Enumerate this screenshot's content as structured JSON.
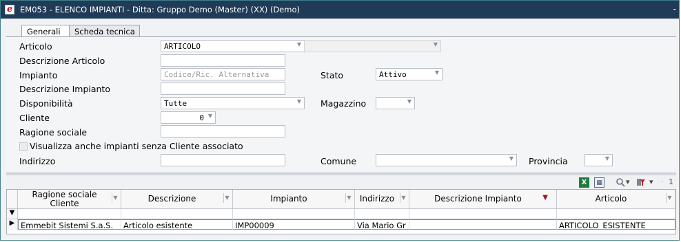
{
  "window": {
    "title": "EM053 - ELENCO IMPIANTI - Ditta: Gruppo Demo (Master) (XX)  (Demo)",
    "app_icon": "e-logo-icon",
    "control": "-"
  },
  "tabs": [
    {
      "label": "Generali",
      "active": true
    },
    {
      "label": "Scheda tecnica",
      "active": false
    }
  ],
  "form": {
    "articolo": {
      "label": "Articolo",
      "value": "ARTICOLO"
    },
    "descrizione_articolo": {
      "label": "Descrizione Articolo",
      "value": ""
    },
    "impianto": {
      "label": "Impianto",
      "placeholder": "Codice/Ric. Alternativa"
    },
    "stato": {
      "label": "Stato",
      "value": "Attivo"
    },
    "descrizione_impianto": {
      "label": "Descrizione Impianto",
      "value": ""
    },
    "disponibilita": {
      "label": "Disponibilità",
      "value": "Tutte"
    },
    "magazzino": {
      "label": "Magazzino",
      "value": ""
    },
    "cliente": {
      "label": "Cliente",
      "value": "0"
    },
    "ragione_sociale": {
      "label": "Ragione sociale",
      "value": ""
    },
    "checkbox_senza_cliente": {
      "label": "Visualizza anche impianti senza Cliente associato",
      "checked": false
    },
    "indirizzo": {
      "label": "Indirizzo",
      "value": ""
    },
    "comune": {
      "label": "Comune",
      "value": ""
    },
    "provincia": {
      "label": "Provincia",
      "value": ""
    }
  },
  "toolbar": {
    "excel_icon": "excel-export-icon",
    "layout_icon": "grid-layout-icon",
    "search_icon": "search-icon",
    "filter_icon": "filter-icon",
    "dropdown_glyph": "▾",
    "trailing": "1"
  },
  "grid": {
    "columns": [
      {
        "label": "Ragione sociale Cliente"
      },
      {
        "label": "Descrizione"
      },
      {
        "label": "Impianto"
      },
      {
        "label": "Indirizzo"
      },
      {
        "label": "Descrizione Impianto",
        "filtered": true
      },
      {
        "label": "Articolo"
      }
    ],
    "rows": [
      [
        "Emmebit Sistemi S.a.S.",
        "Articolo esistente",
        "IMP00009",
        "Via Mario Gr",
        "",
        "ARTICOLO_ESISTENTE"
      ]
    ]
  }
}
